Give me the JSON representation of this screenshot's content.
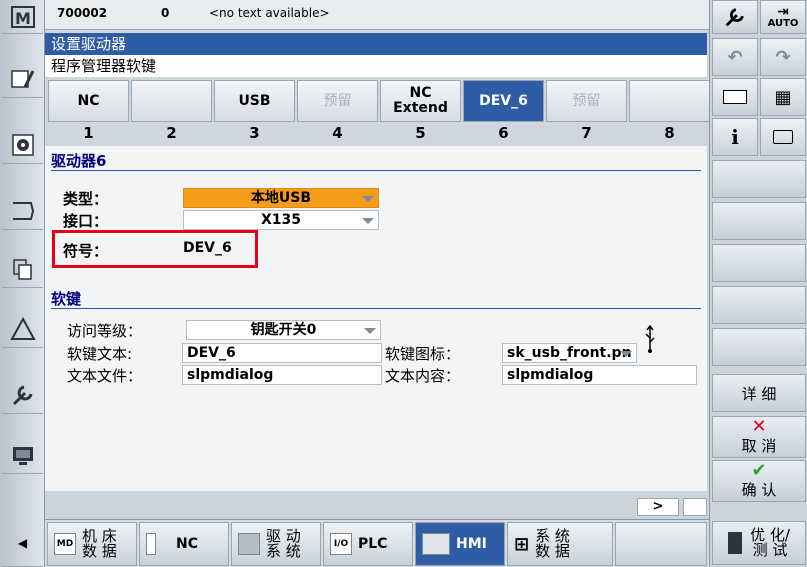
{
  "status": {
    "program": "700002",
    "channel": "0",
    "message": "<no text available>",
    "mode": "AUTO"
  },
  "header": {
    "title": "设置驱动器",
    "subtitle": "程序管理器软键"
  },
  "drives": [
    {
      "label": "NC",
      "num": "1",
      "state": "normal"
    },
    {
      "label": "",
      "num": "2",
      "state": "normal"
    },
    {
      "label": "USB",
      "num": "3",
      "state": "normal"
    },
    {
      "label": "预留",
      "num": "4",
      "state": "disabled"
    },
    {
      "label": "NC\nExtend",
      "num": "5",
      "state": "normal"
    },
    {
      "label": "DEV_6",
      "num": "6",
      "state": "active"
    },
    {
      "label": "预留",
      "num": "7",
      "state": "disabled"
    },
    {
      "label": "",
      "num": "8",
      "state": "normal"
    }
  ],
  "drive_section": {
    "heading": "驱动器6",
    "type_label": "类型：",
    "type_value": "本地USB",
    "interface_label": "接口：",
    "interface_value": "X135",
    "symbol_label": "符号：",
    "symbol_value": "DEV_6"
  },
  "softkey_section": {
    "heading": "软键",
    "access_label": "访问等级：",
    "access_value": "钥匙开关0",
    "text_label": "软键文本:",
    "text_value": "DEV_6",
    "icon_label": "软键图标：",
    "icon_value": "sk_usb_front.pn",
    "file_label": "文本文件：",
    "file_value": "slpmdialog",
    "content_label": "文本内容：",
    "content_value": "slpmdialog"
  },
  "right_softkeys": {
    "details": "详 细",
    "cancel": "取 消",
    "ok": "确 认",
    "optimize": "优 化/\n测 试"
  },
  "scroll_next": ">",
  "bottom_softkeys": [
    {
      "icon": "MD",
      "label": "机 床\n数 据"
    },
    {
      "icon": "nc-module",
      "label": "NC"
    },
    {
      "icon": "drive-module",
      "label": "驱 动\n系 统"
    },
    {
      "icon": "plc-module",
      "label": "PLC"
    },
    {
      "icon": "hmi-screen",
      "label": "HMI"
    },
    {
      "icon": "system-tree",
      "label": "系 统\n数 据"
    }
  ],
  "colors": {
    "accent": "#2f5da5",
    "highlight": "#f59c1a",
    "marker": "#e3001b"
  }
}
